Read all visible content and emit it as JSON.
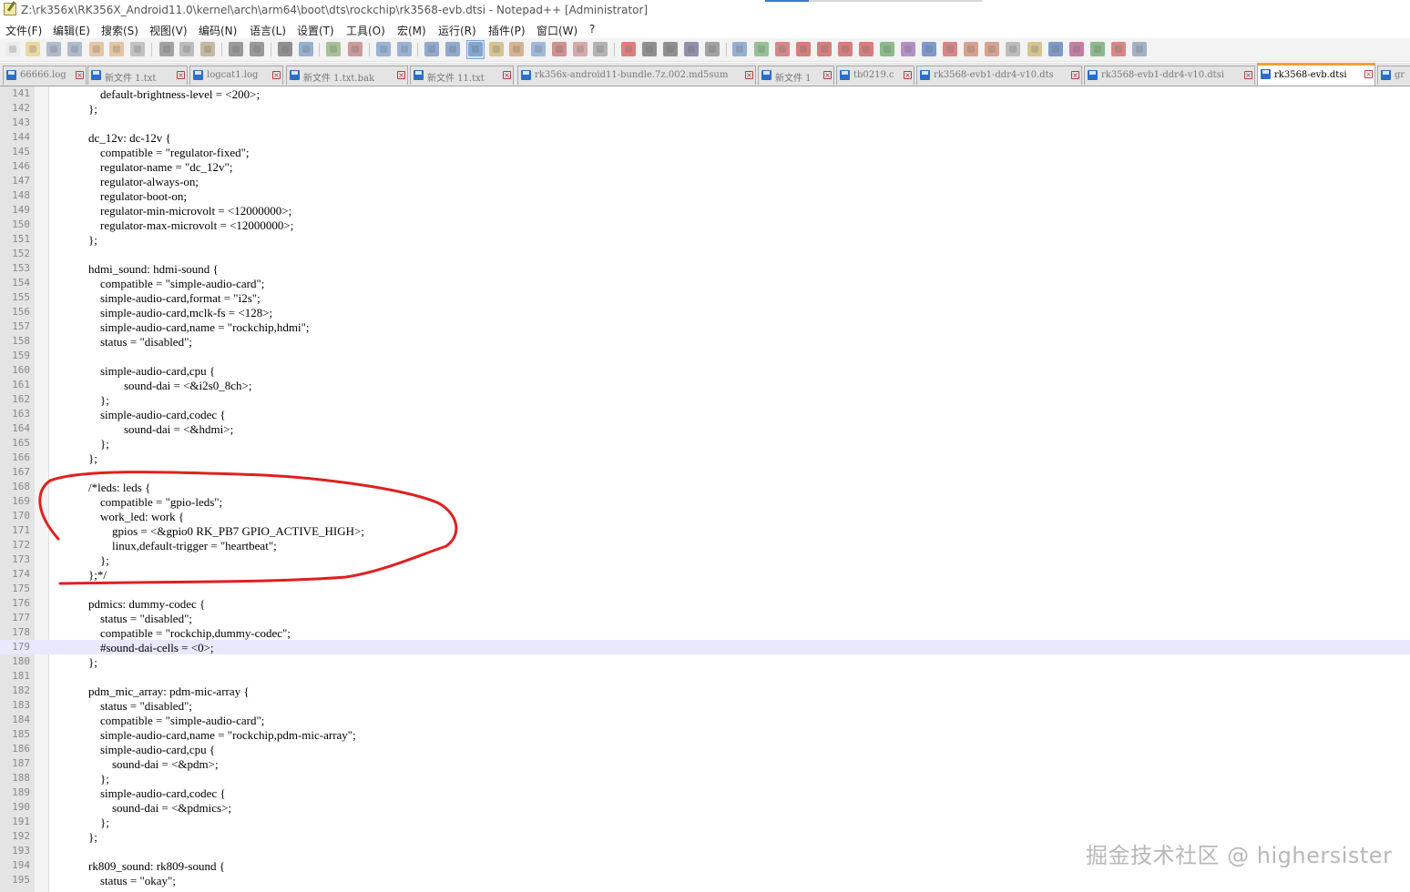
{
  "window": {
    "title": "Z:\\rk356x\\RK356X_Android11.0\\kernel\\arch\\arm64\\boot\\dts\\rockchip\\rk3568-evb.dtsi - Notepad++ [Administrator]"
  },
  "menu": [
    {
      "label": "文件(F)",
      "name": "menu-file"
    },
    {
      "label": "编辑(E)",
      "name": "menu-edit"
    },
    {
      "label": "搜索(S)",
      "name": "menu-search"
    },
    {
      "label": "视图(V)",
      "name": "menu-view"
    },
    {
      "label": "编码(N)",
      "name": "menu-encoding"
    },
    {
      "label": "语言(L)",
      "name": "menu-language"
    },
    {
      "label": "设置(T)",
      "name": "menu-settings"
    },
    {
      "label": "工具(O)",
      "name": "menu-tools"
    },
    {
      "label": "宏(M)",
      "name": "menu-macro"
    },
    {
      "label": "运行(R)",
      "name": "menu-run"
    },
    {
      "label": "插件(P)",
      "name": "menu-plugins"
    },
    {
      "label": "窗口(W)",
      "name": "menu-window"
    },
    {
      "label": "?",
      "name": "menu-help"
    }
  ],
  "toolbar": [
    {
      "icon": "new-file-icon",
      "color": "#e8e8e8"
    },
    {
      "icon": "open-file-icon",
      "color": "#e8c45a"
    },
    {
      "icon": "save-icon",
      "color": "#7a8fb0"
    },
    {
      "icon": "save-all-icon",
      "color": "#7a8fb0"
    },
    {
      "icon": "close-icon",
      "color": "#d8a060"
    },
    {
      "icon": "close-all-icon",
      "color": "#d8a060"
    },
    {
      "icon": "print-icon",
      "color": "#9a9a9a"
    },
    {
      "icon": "cut-icon",
      "color": "#606060"
    },
    {
      "icon": "copy-icon",
      "color": "#909090"
    },
    {
      "icon": "paste-icon",
      "color": "#a08a60"
    },
    {
      "icon": "undo-icon",
      "color": "#505050"
    },
    {
      "icon": "redo-icon",
      "color": "#505050"
    },
    {
      "icon": "find-icon",
      "color": "#404040"
    },
    {
      "icon": "replace-icon",
      "color": "#4a7ab8"
    },
    {
      "icon": "zoom-in-icon",
      "color": "#6a9a4a"
    },
    {
      "icon": "zoom-out-icon",
      "color": "#b05050"
    },
    {
      "icon": "sync-vertical-icon",
      "color": "#5080c0"
    },
    {
      "icon": "sync-horizontal-icon",
      "color": "#5080c0"
    },
    {
      "icon": "word-wrap-icon",
      "color": "#4070b0"
    },
    {
      "icon": "show-all-chars-icon",
      "color": "#4070b0"
    },
    {
      "icon": "indent-guide-icon",
      "color": "#4070b0"
    },
    {
      "icon": "user-language-icon",
      "color": "#c0a040"
    },
    {
      "icon": "doc-map-icon",
      "color": "#c08040"
    },
    {
      "icon": "function-list-icon",
      "color": "#5a8ac8"
    },
    {
      "icon": "folder-workspace-icon",
      "color": "#b04040"
    },
    {
      "icon": "monitor-icon",
      "color": "#c07070"
    },
    {
      "icon": "view-icon",
      "color": "#808080"
    },
    {
      "icon": "record-macro-icon",
      "color": "#d02020"
    },
    {
      "icon": "stop-macro-icon",
      "color": "#404040"
    },
    {
      "icon": "play-macro-icon",
      "color": "#404040"
    },
    {
      "icon": "run-macro-multiple-icon",
      "color": "#404070"
    },
    {
      "icon": "save-macro-icon",
      "color": "#606060"
    },
    {
      "icon": "plugin-compare-icon",
      "color": "#4a7ab8"
    },
    {
      "icon": "plugin-check-icon",
      "color": "#4a9a4a"
    },
    {
      "icon": "plugin-red-icon",
      "color": "#c03030"
    },
    {
      "icon": "first-diff-icon",
      "color": "#c02020"
    },
    {
      "icon": "prev-diff-icon",
      "color": "#c02020"
    },
    {
      "icon": "next-diff-icon",
      "color": "#c02020"
    },
    {
      "icon": "last-diff-icon",
      "color": "#c02020"
    },
    {
      "icon": "plugin-green-icon",
      "color": "#3a8a3a"
    },
    {
      "icon": "plugin-purple-icon",
      "color": "#8040a0"
    },
    {
      "icon": "plugin-blue-icon",
      "color": "#2050b0"
    },
    {
      "icon": "plugin-pin-icon",
      "color": "#c03030"
    },
    {
      "icon": "plugin-doc-icon",
      "color": "#c06040"
    },
    {
      "icon": "plugin-doc2-icon",
      "color": "#c06040"
    },
    {
      "icon": "plugin-search-icon",
      "color": "#909090"
    },
    {
      "icon": "plugin-edit-icon",
      "color": "#c0a040"
    },
    {
      "icon": "ampersand-icon",
      "color": "#2050a0"
    },
    {
      "icon": "ampersand-red-icon",
      "color": "#a02060"
    },
    {
      "icon": "arrows-icon",
      "color": "#3a8a3a"
    },
    {
      "icon": "check-mark-icon",
      "color": "#c03030"
    },
    {
      "icon": "settings-tool-icon",
      "color": "#6080a0"
    }
  ],
  "tabs": [
    {
      "label": "66666.log",
      "active": false
    },
    {
      "label": "新文件 1.txt",
      "active": false
    },
    {
      "label": "logcat1.log",
      "active": false
    },
    {
      "label": "新文件 1.txt.bak",
      "active": false
    },
    {
      "label": "新文件 11.txt",
      "active": false
    },
    {
      "label": "rk356x-android11-bundle.7z.002.md5sum",
      "active": false
    },
    {
      "label": "新文件 1",
      "active": false
    },
    {
      "label": "tb0219.c",
      "active": false
    },
    {
      "label": "rk3568-evb1-ddr4-v10.dts",
      "active": false
    },
    {
      "label": "rk3568-evb1-ddr4-v10.dtsi",
      "active": false
    },
    {
      "label": "rk3568-evb.dtsi",
      "active": true
    },
    {
      "label": "gr",
      "active": false
    }
  ],
  "editor": {
    "current_line": 179,
    "lines": [
      {
        "n": "141",
        "text": "        default-brightness-level = <200>;"
      },
      {
        "n": "142",
        "text": "    };"
      },
      {
        "n": "143",
        "text": ""
      },
      {
        "n": "144",
        "text": "    dc_12v: dc-12v {"
      },
      {
        "n": "145",
        "text": "        compatible = \"regulator-fixed\";"
      },
      {
        "n": "146",
        "text": "        regulator-name = \"dc_12v\";"
      },
      {
        "n": "147",
        "text": "        regulator-always-on;"
      },
      {
        "n": "148",
        "text": "        regulator-boot-on;"
      },
      {
        "n": "149",
        "text": "        regulator-min-microvolt = <12000000>;"
      },
      {
        "n": "150",
        "text": "        regulator-max-microvolt = <12000000>;"
      },
      {
        "n": "151",
        "text": "    };"
      },
      {
        "n": "152",
        "text": ""
      },
      {
        "n": "153",
        "text": "    hdmi_sound: hdmi-sound {"
      },
      {
        "n": "154",
        "text": "        compatible = \"simple-audio-card\";"
      },
      {
        "n": "155",
        "text": "        simple-audio-card,format = \"i2s\";"
      },
      {
        "n": "156",
        "text": "        simple-audio-card,mclk-fs = <128>;"
      },
      {
        "n": "157",
        "text": "        simple-audio-card,name = \"rockchip,hdmi\";"
      },
      {
        "n": "158",
        "text": "        status = \"disabled\";"
      },
      {
        "n": "159",
        "text": ""
      },
      {
        "n": "160",
        "text": "        simple-audio-card,cpu {"
      },
      {
        "n": "161",
        "text": "                sound-dai = <&i2s0_8ch>;"
      },
      {
        "n": "162",
        "text": "        };"
      },
      {
        "n": "163",
        "text": "        simple-audio-card,codec {"
      },
      {
        "n": "164",
        "text": "                sound-dai = <&hdmi>;"
      },
      {
        "n": "165",
        "text": "        };"
      },
      {
        "n": "166",
        "text": "    };"
      },
      {
        "n": "167",
        "text": ""
      },
      {
        "n": "168",
        "text": "    /*leds: leds {"
      },
      {
        "n": "169",
        "text": "        compatible = \"gpio-leds\";"
      },
      {
        "n": "170",
        "text": "        work_led: work {"
      },
      {
        "n": "171",
        "text": "            gpios = <&gpio0 RK_PB7 GPIO_ACTIVE_HIGH>;"
      },
      {
        "n": "172",
        "text": "            linux,default-trigger = \"heartbeat\";"
      },
      {
        "n": "173",
        "text": "        };"
      },
      {
        "n": "174",
        "text": "    };*/"
      },
      {
        "n": "175",
        "text": ""
      },
      {
        "n": "176",
        "text": "    pdmics: dummy-codec {"
      },
      {
        "n": "177",
        "text": "        status = \"disabled\";"
      },
      {
        "n": "178",
        "text": "        compatible = \"rockchip,dummy-codec\";"
      },
      {
        "n": "179",
        "text": "        #sound-dai-cells = <0>;"
      },
      {
        "n": "180",
        "text": "    };"
      },
      {
        "n": "181",
        "text": ""
      },
      {
        "n": "182",
        "text": "    pdm_mic_array: pdm-mic-array {"
      },
      {
        "n": "183",
        "text": "        status = \"disabled\";"
      },
      {
        "n": "184",
        "text": "        compatible = \"simple-audio-card\";"
      },
      {
        "n": "185",
        "text": "        simple-audio-card,name = \"rockchip,pdm-mic-array\";"
      },
      {
        "n": "186",
        "text": "        simple-audio-card,cpu {"
      },
      {
        "n": "187",
        "text": "            sound-dai = <&pdm>;"
      },
      {
        "n": "188",
        "text": "        };"
      },
      {
        "n": "189",
        "text": "        simple-audio-card,codec {"
      },
      {
        "n": "190",
        "text": "            sound-dai = <&pdmics>;"
      },
      {
        "n": "191",
        "text": "        };"
      },
      {
        "n": "192",
        "text": "    };"
      },
      {
        "n": "193",
        "text": ""
      },
      {
        "n": "194",
        "text": "    rk809_sound: rk809-sound {"
      },
      {
        "n": "195",
        "text": "        status = \"okay\";"
      }
    ]
  },
  "annotation": {
    "color": "#e02020"
  },
  "watermark": "掘金技术社区 @ highersister"
}
